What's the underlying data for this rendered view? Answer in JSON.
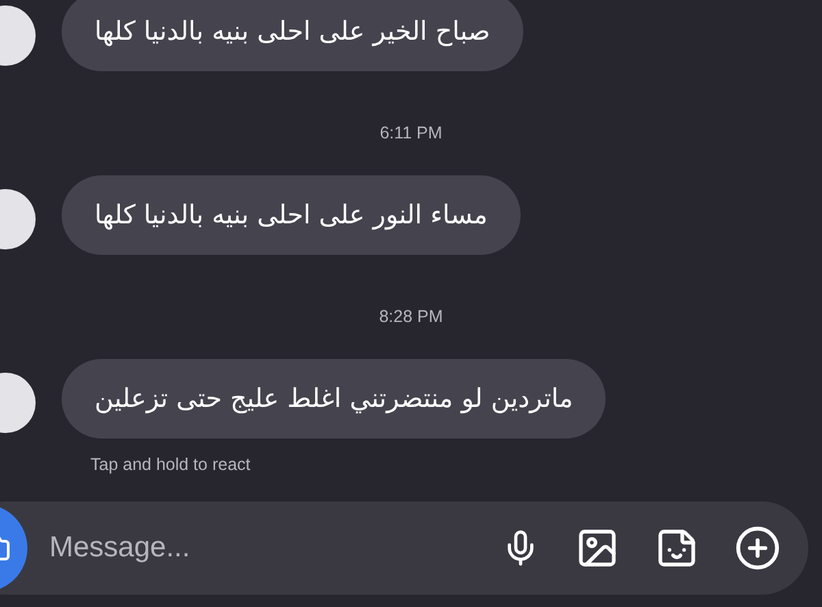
{
  "thread": [
    {
      "kind": "message",
      "text": "صباح الخير على احلى بنيه بالدنيا كلها"
    },
    {
      "kind": "time",
      "text": "6:11 PM"
    },
    {
      "kind": "message",
      "text": "مساء النور على احلى بنيه بالدنيا كلها"
    },
    {
      "kind": "time",
      "text": "8:28 PM"
    },
    {
      "kind": "message",
      "text": "ماتردين لو منتضرتني اغلط عليج حتى تزعلين"
    }
  ],
  "hint": "Tap and hold to react",
  "composer": {
    "placeholder": "Message..."
  }
}
